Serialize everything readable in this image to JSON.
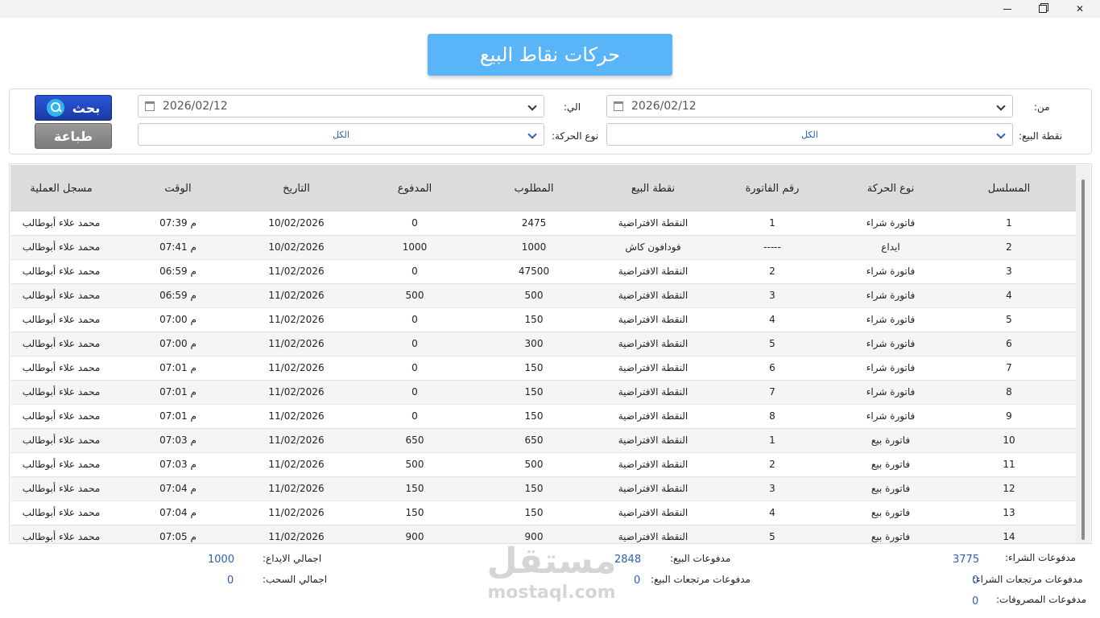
{
  "window": {
    "minimize_icon": "minimize-icon",
    "maximize_icon": "restore-icon",
    "close_glyph": "✕"
  },
  "title": "حركات نقاط البيع",
  "filters": {
    "from_label": "من:",
    "to_label": "الي:",
    "from_date": "2026/02/12",
    "to_date": "2026/02/12",
    "pos_label": "نقطة البيع:",
    "pos_value": "الكل",
    "type_label": "نوع الحركة:",
    "type_value": "الكل"
  },
  "buttons": {
    "search": "بحث",
    "print": "طباعة"
  },
  "table": {
    "headers": {
      "serial": "المسلسل",
      "type": "نوع الحركة",
      "invoice": "رقم الفاتورة",
      "pos": "نقطة البيع",
      "required": "المطلوب",
      "paid": "المدفوع",
      "date": "التاريخ",
      "time": "الوقت",
      "user": "مسجل العملية"
    },
    "rows": [
      {
        "serial": "1",
        "type": "فاتورة شراء",
        "invoice": "1",
        "pos": "النقطة الافتراضية",
        "required": "2475",
        "paid": "0",
        "date": "10/02/2026",
        "time": "07:39 م",
        "user": "محمد علاء أبوطالب"
      },
      {
        "serial": "2",
        "type": "ايداع",
        "invoice": "-----",
        "pos": "فودافون كاش",
        "required": "1000",
        "paid": "1000",
        "date": "10/02/2026",
        "time": "07:41 م",
        "user": "محمد علاء أبوطالب"
      },
      {
        "serial": "3",
        "type": "فاتورة شراء",
        "invoice": "2",
        "pos": "النقطة الافتراضية",
        "required": "47500",
        "paid": "0",
        "date": "11/02/2026",
        "time": "06:59 م",
        "user": "محمد علاء أبوطالب"
      },
      {
        "serial": "4",
        "type": "فاتورة شراء",
        "invoice": "3",
        "pos": "النقطة الافتراضية",
        "required": "500",
        "paid": "500",
        "date": "11/02/2026",
        "time": "06:59 م",
        "user": "محمد علاء أبوطالب"
      },
      {
        "serial": "5",
        "type": "فاتورة شراء",
        "invoice": "4",
        "pos": "النقطة الافتراضية",
        "required": "150",
        "paid": "0",
        "date": "11/02/2026",
        "time": "07:00 م",
        "user": "محمد علاء أبوطالب"
      },
      {
        "serial": "6",
        "type": "فاتورة شراء",
        "invoice": "5",
        "pos": "النقطة الافتراضية",
        "required": "300",
        "paid": "0",
        "date": "11/02/2026",
        "time": "07:00 م",
        "user": "محمد علاء أبوطالب"
      },
      {
        "serial": "7",
        "type": "فاتورة شراء",
        "invoice": "6",
        "pos": "النقطة الافتراضية",
        "required": "150",
        "paid": "0",
        "date": "11/02/2026",
        "time": "07:01 م",
        "user": "محمد علاء أبوطالب"
      },
      {
        "serial": "8",
        "type": "فاتورة شراء",
        "invoice": "7",
        "pos": "النقطة الافتراضية",
        "required": "150",
        "paid": "0",
        "date": "11/02/2026",
        "time": "07:01 م",
        "user": "محمد علاء أبوطالب"
      },
      {
        "serial": "9",
        "type": "فاتورة شراء",
        "invoice": "8",
        "pos": "النقطة الافتراضية",
        "required": "150",
        "paid": "0",
        "date": "11/02/2026",
        "time": "07:01 م",
        "user": "محمد علاء أبوطالب"
      },
      {
        "serial": "10",
        "type": "فاتورة بيع",
        "invoice": "1",
        "pos": "النقطة الافتراضية",
        "required": "650",
        "paid": "650",
        "date": "11/02/2026",
        "time": "07:03 م",
        "user": "محمد علاء أبوطالب"
      },
      {
        "serial": "11",
        "type": "فاتورة بيع",
        "invoice": "2",
        "pos": "النقطة الافتراضية",
        "required": "500",
        "paid": "500",
        "date": "11/02/2026",
        "time": "07:03 م",
        "user": "محمد علاء أبوطالب"
      },
      {
        "serial": "12",
        "type": "فاتورة بيع",
        "invoice": "3",
        "pos": "النقطة الافتراضية",
        "required": "150",
        "paid": "150",
        "date": "11/02/2026",
        "time": "07:04 م",
        "user": "محمد علاء أبوطالب"
      },
      {
        "serial": "13",
        "type": "فاتورة بيع",
        "invoice": "4",
        "pos": "النقطة الافتراضية",
        "required": "150",
        "paid": "150",
        "date": "11/02/2026",
        "time": "07:04 م",
        "user": "محمد علاء أبوطالب"
      },
      {
        "serial": "14",
        "type": "فاتورة بيع",
        "invoice": "5",
        "pos": "النقطة الافتراضية",
        "required": "900",
        "paid": "900",
        "date": "11/02/2026",
        "time": "07:05 م",
        "user": "محمد علاء أبوطالب"
      }
    ]
  },
  "totals": {
    "purchase_payments_label": "مدفوعات الشراء:",
    "purchase_payments": "3775",
    "purchase_returns_label": "مدفوعات مرتجعات الشراء:",
    "purchase_returns": "0",
    "expenses_label": "مدفوعات المصروفات:",
    "expenses": "0",
    "sales_payments_label": "مدفوعات البيع:",
    "sales_payments": "2848",
    "sales_returns_label": "مدفوعات مرتجعات البيع:",
    "sales_returns": "0",
    "deposits_label": "اجمالي الايداع:",
    "deposits": "1000",
    "withdrawals_label": "اجمالي السحب:",
    "withdrawals": "0"
  },
  "watermark": {
    "arabic": "مستقل",
    "latin": "mostaql.com"
  },
  "colors": {
    "title_banner": "#5ab4f8",
    "search_button": "#1f46c0",
    "print_button": "#8a8a8a",
    "value_text": "#2b5fb3"
  }
}
